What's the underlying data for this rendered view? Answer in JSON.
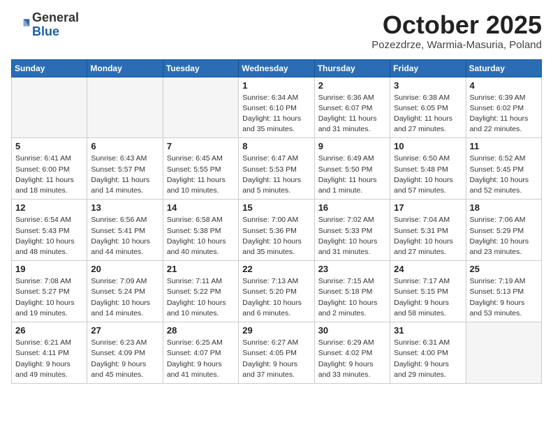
{
  "header": {
    "logo_general": "General",
    "logo_blue": "Blue",
    "month_title": "October 2025",
    "subtitle": "Pozezdrze, Warmia-Masuria, Poland"
  },
  "days_of_week": [
    "Sunday",
    "Monday",
    "Tuesday",
    "Wednesday",
    "Thursday",
    "Friday",
    "Saturday"
  ],
  "weeks": [
    [
      {
        "day": "",
        "info": ""
      },
      {
        "day": "",
        "info": ""
      },
      {
        "day": "",
        "info": ""
      },
      {
        "day": "1",
        "info": "Sunrise: 6:34 AM\nSunset: 6:10 PM\nDaylight: 11 hours\nand 35 minutes."
      },
      {
        "day": "2",
        "info": "Sunrise: 6:36 AM\nSunset: 6:07 PM\nDaylight: 11 hours\nand 31 minutes."
      },
      {
        "day": "3",
        "info": "Sunrise: 6:38 AM\nSunset: 6:05 PM\nDaylight: 11 hours\nand 27 minutes."
      },
      {
        "day": "4",
        "info": "Sunrise: 6:39 AM\nSunset: 6:02 PM\nDaylight: 11 hours\nand 22 minutes."
      }
    ],
    [
      {
        "day": "5",
        "info": "Sunrise: 6:41 AM\nSunset: 6:00 PM\nDaylight: 11 hours\nand 18 minutes."
      },
      {
        "day": "6",
        "info": "Sunrise: 6:43 AM\nSunset: 5:57 PM\nDaylight: 11 hours\nand 14 minutes."
      },
      {
        "day": "7",
        "info": "Sunrise: 6:45 AM\nSunset: 5:55 PM\nDaylight: 11 hours\nand 10 minutes."
      },
      {
        "day": "8",
        "info": "Sunrise: 6:47 AM\nSunset: 5:53 PM\nDaylight: 11 hours\nand 5 minutes."
      },
      {
        "day": "9",
        "info": "Sunrise: 6:49 AM\nSunset: 5:50 PM\nDaylight: 11 hours\nand 1 minute."
      },
      {
        "day": "10",
        "info": "Sunrise: 6:50 AM\nSunset: 5:48 PM\nDaylight: 10 hours\nand 57 minutes."
      },
      {
        "day": "11",
        "info": "Sunrise: 6:52 AM\nSunset: 5:45 PM\nDaylight: 10 hours\nand 52 minutes."
      }
    ],
    [
      {
        "day": "12",
        "info": "Sunrise: 6:54 AM\nSunset: 5:43 PM\nDaylight: 10 hours\nand 48 minutes."
      },
      {
        "day": "13",
        "info": "Sunrise: 6:56 AM\nSunset: 5:41 PM\nDaylight: 10 hours\nand 44 minutes."
      },
      {
        "day": "14",
        "info": "Sunrise: 6:58 AM\nSunset: 5:38 PM\nDaylight: 10 hours\nand 40 minutes."
      },
      {
        "day": "15",
        "info": "Sunrise: 7:00 AM\nSunset: 5:36 PM\nDaylight: 10 hours\nand 35 minutes."
      },
      {
        "day": "16",
        "info": "Sunrise: 7:02 AM\nSunset: 5:33 PM\nDaylight: 10 hours\nand 31 minutes."
      },
      {
        "day": "17",
        "info": "Sunrise: 7:04 AM\nSunset: 5:31 PM\nDaylight: 10 hours\nand 27 minutes."
      },
      {
        "day": "18",
        "info": "Sunrise: 7:06 AM\nSunset: 5:29 PM\nDaylight: 10 hours\nand 23 minutes."
      }
    ],
    [
      {
        "day": "19",
        "info": "Sunrise: 7:08 AM\nSunset: 5:27 PM\nDaylight: 10 hours\nand 19 minutes."
      },
      {
        "day": "20",
        "info": "Sunrise: 7:09 AM\nSunset: 5:24 PM\nDaylight: 10 hours\nand 14 minutes."
      },
      {
        "day": "21",
        "info": "Sunrise: 7:11 AM\nSunset: 5:22 PM\nDaylight: 10 hours\nand 10 minutes."
      },
      {
        "day": "22",
        "info": "Sunrise: 7:13 AM\nSunset: 5:20 PM\nDaylight: 10 hours\nand 6 minutes."
      },
      {
        "day": "23",
        "info": "Sunrise: 7:15 AM\nSunset: 5:18 PM\nDaylight: 10 hours\nand 2 minutes."
      },
      {
        "day": "24",
        "info": "Sunrise: 7:17 AM\nSunset: 5:15 PM\nDaylight: 9 hours\nand 58 minutes."
      },
      {
        "day": "25",
        "info": "Sunrise: 7:19 AM\nSunset: 5:13 PM\nDaylight: 9 hours\nand 53 minutes."
      }
    ],
    [
      {
        "day": "26",
        "info": "Sunrise: 6:21 AM\nSunset: 4:11 PM\nDaylight: 9 hours\nand 49 minutes."
      },
      {
        "day": "27",
        "info": "Sunrise: 6:23 AM\nSunset: 4:09 PM\nDaylight: 9 hours\nand 45 minutes."
      },
      {
        "day": "28",
        "info": "Sunrise: 6:25 AM\nSunset: 4:07 PM\nDaylight: 9 hours\nand 41 minutes."
      },
      {
        "day": "29",
        "info": "Sunrise: 6:27 AM\nSunset: 4:05 PM\nDaylight: 9 hours\nand 37 minutes."
      },
      {
        "day": "30",
        "info": "Sunrise: 6:29 AM\nSunset: 4:02 PM\nDaylight: 9 hours\nand 33 minutes."
      },
      {
        "day": "31",
        "info": "Sunrise: 6:31 AM\nSunset: 4:00 PM\nDaylight: 9 hours\nand 29 minutes."
      },
      {
        "day": "",
        "info": ""
      }
    ]
  ]
}
